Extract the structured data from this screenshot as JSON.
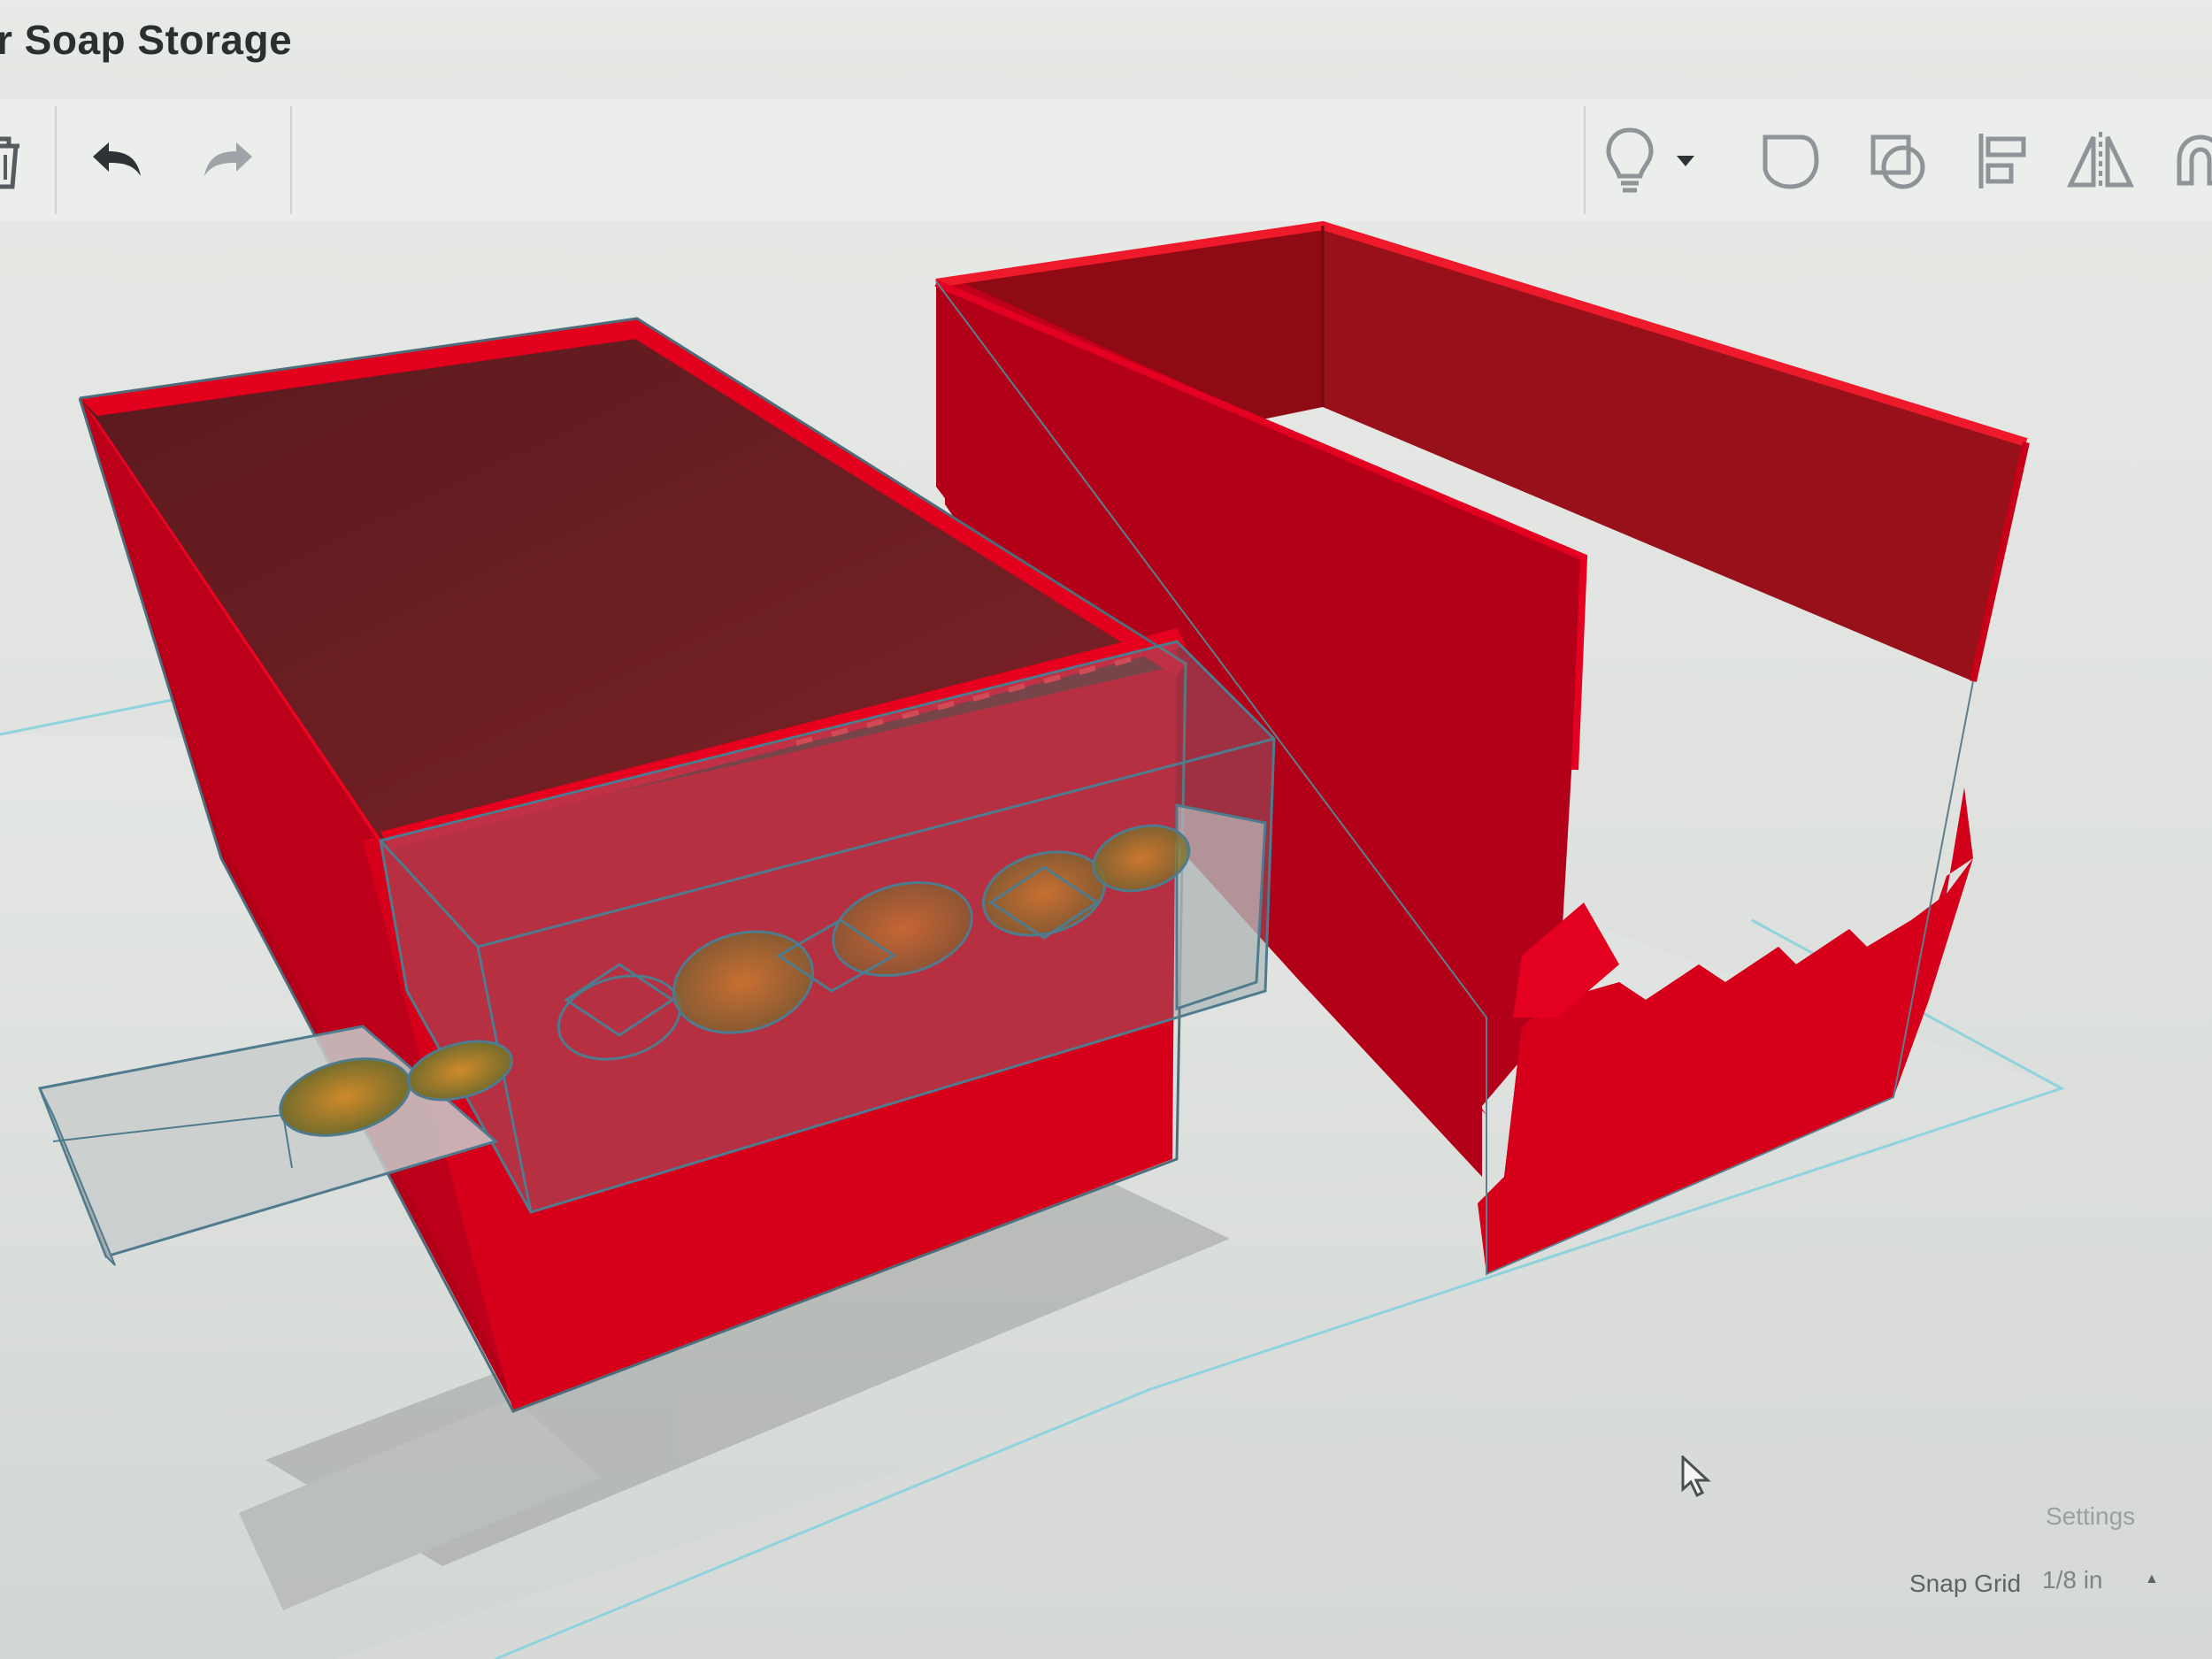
{
  "window": {
    "title": "r Soap Storage"
  },
  "toolbar": {
    "left_tools": [
      {
        "name": "delete",
        "icon": "trash-icon"
      },
      {
        "name": "undo",
        "icon": "undo-arrow-icon"
      },
      {
        "name": "redo",
        "icon": "redo-arrow-icon"
      }
    ],
    "right_tools": [
      {
        "name": "show-hide",
        "icon": "lightbulb-icon"
      },
      {
        "name": "show-hide-menu",
        "icon": "caret-down-icon"
      },
      {
        "name": "group",
        "icon": "group-icon"
      },
      {
        "name": "ungroup",
        "icon": "ungroup-icon"
      },
      {
        "name": "align",
        "icon": "align-icon"
      },
      {
        "name": "mirror",
        "icon": "mirror-icon"
      },
      {
        "name": "cruise",
        "icon": "magnet-icon"
      }
    ]
  },
  "workplane": {
    "settings_label": "Settings",
    "snap_grid_label": "Snap Grid",
    "snap_grid_value": "1/8 in"
  },
  "colors": {
    "shape_red": "#d9001b",
    "shape_red_dark": "#8e0a14",
    "shape_red_shadow": "#a80012",
    "hole_outline": "#4f7b8f",
    "grid_line": "#8fd3df",
    "soap_orange": "#c77418",
    "soap_green": "#5f7a33"
  }
}
